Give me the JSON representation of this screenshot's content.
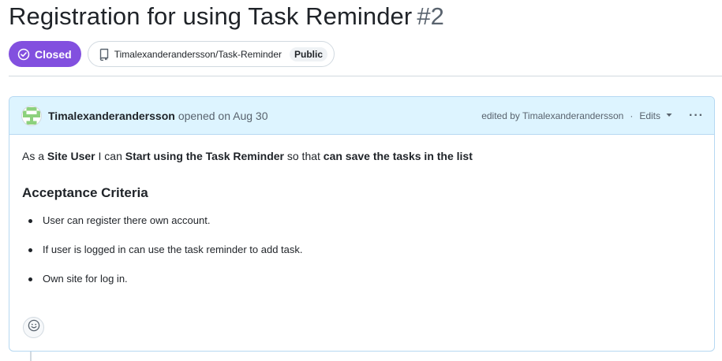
{
  "issue": {
    "title": "Registration for using Task Reminder",
    "number": "#2",
    "state_label": "Closed",
    "state_color": "#8250df",
    "repo": "Timalexanderandersson/Task-Reminder",
    "visibility": "Public"
  },
  "comment": {
    "author": "Timalexanderandersson",
    "opened_text": "opened on Aug 30",
    "edited_by_text": "edited by Timalexanderandersson",
    "separator": "·",
    "edits_label": "Edits",
    "more_label": "···",
    "story": {
      "p1": "As a ",
      "b1": "Site User",
      "p2": " I can ",
      "b2": "Start using the Task Reminder",
      "p3": " so that ",
      "b3": "can save the tasks in the list"
    },
    "criteria_heading": "Acceptance Criteria",
    "criteria": [
      "User can register there own account.",
      "If user is logged in can use the task reminder to add task.",
      "Own site for log in."
    ]
  },
  "icons": {
    "state": "check-circle-icon",
    "repo": "repo-icon",
    "avatar": "identicon",
    "edits_caret": "triangle-down-icon",
    "reaction": "smiley-icon"
  },
  "colors": {
    "header_bg": "#ddf4ff",
    "header_border": "#b6d8f2",
    "avatar_green": "#8cd17d"
  }
}
